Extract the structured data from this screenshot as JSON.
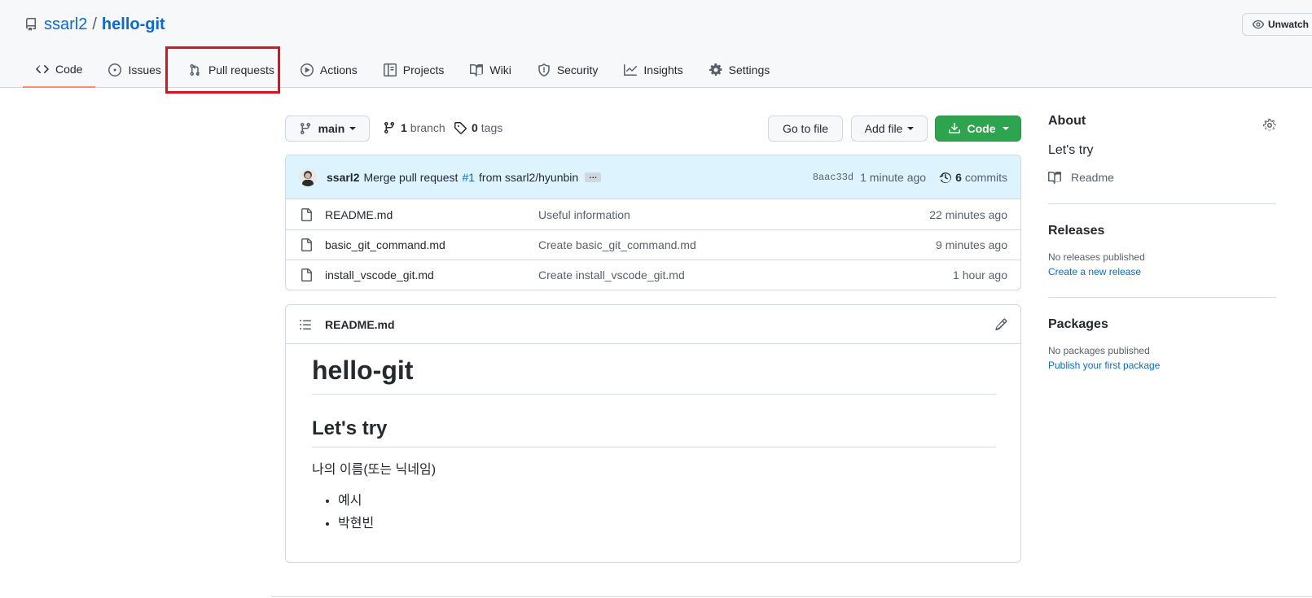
{
  "repo": {
    "owner": "ssarl2",
    "separator": "/",
    "name": "hello-git",
    "unwatch_label": "Unwatch"
  },
  "tabs": [
    {
      "label": "Code",
      "icon": "code-icon",
      "selected": true
    },
    {
      "label": "Issues",
      "icon": "issue-icon"
    },
    {
      "label": "Pull requests",
      "icon": "pull-request-icon"
    },
    {
      "label": "Actions",
      "icon": "play-icon"
    },
    {
      "label": "Projects",
      "icon": "table-icon"
    },
    {
      "label": "Wiki",
      "icon": "book-icon"
    },
    {
      "label": "Security",
      "icon": "shield-icon"
    },
    {
      "label": "Insights",
      "icon": "graph-icon"
    },
    {
      "label": "Settings",
      "icon": "gear-icon"
    }
  ],
  "toolbar": {
    "branch_label": "main",
    "branch_count": "1",
    "branch_text": "branch",
    "tag_count": "0",
    "tag_text": "tags",
    "goto_file": "Go to file",
    "add_file": "Add file",
    "code_button": "Code"
  },
  "commit": {
    "author": "ssarl2",
    "message_prefix": "Merge pull request",
    "issue": "#1",
    "message_suffix": "from ssarl2/hyunbin",
    "ellipsis": "…",
    "sha": "8aac33d",
    "age": "1 minute ago",
    "count": "6",
    "count_label": "commits"
  },
  "files": [
    {
      "name": "README.md",
      "message": "Useful information",
      "age": "22 minutes ago"
    },
    {
      "name": "basic_git_command.md",
      "message": "Create basic_git_command.md",
      "age": "9 minutes ago"
    },
    {
      "name": "install_vscode_git.md",
      "message": "Create install_vscode_git.md",
      "age": "1 hour ago"
    }
  ],
  "readme": {
    "filename": "README.md",
    "h1": "hello-git",
    "h2": "Let's try",
    "paragraph": "나의 이름(또는 닉네임)",
    "bullets": [
      "예시",
      "박현빈"
    ]
  },
  "sidebar": {
    "about_title": "About",
    "about_text": "Let's try",
    "readme_link": "Readme",
    "releases_title": "Releases",
    "releases_empty": "No releases published",
    "releases_link": "Create a new release",
    "packages_title": "Packages",
    "packages_empty": "No packages published",
    "packages_link": "Publish your first package"
  },
  "colors": {
    "accent_link": "#0969da",
    "green_button": "#2da44e",
    "selected_tab_underline": "#fd8c73",
    "annotation_box": "#e0101e",
    "commit_bar_bg": "#ddf4ff"
  }
}
